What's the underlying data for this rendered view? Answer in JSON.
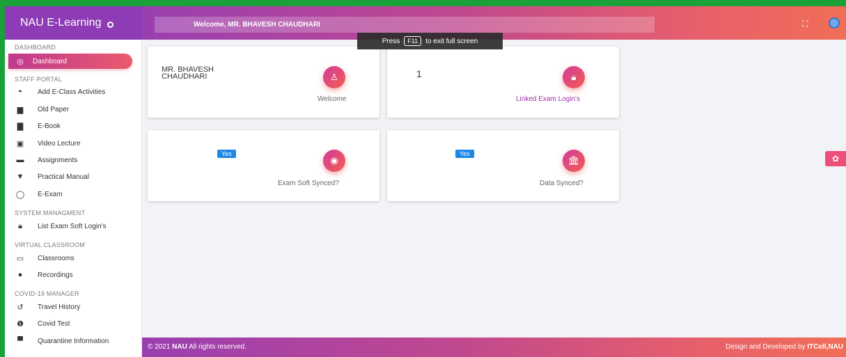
{
  "brand": {
    "title": "NAU E-Learning"
  },
  "header": {
    "welcome": "Welcome, MR. BHAVESH CHAUDHARI"
  },
  "fullscreen_tip": {
    "press": "Press",
    "key": "F11",
    "rest": "to exit full screen"
  },
  "sidebar": {
    "sections": [
      {
        "title": "DASHBOARD"
      },
      {
        "title": "STAFF PORTAL"
      },
      {
        "title": "SYSTEM MANAGMENT"
      },
      {
        "title": "VIRTUAL CLASSROOM"
      },
      {
        "title": "COVID-19 MANAGER"
      }
    ],
    "items": [
      {
        "label": "Dashboard",
        "icon": "palette-icon"
      },
      {
        "label": "Add E-Class Activities",
        "icon": "eye-icon"
      },
      {
        "label": "Old Paper",
        "icon": "file-icon"
      },
      {
        "label": "E-Book",
        "icon": "save-icon"
      },
      {
        "label": "Video Lecture",
        "icon": "video-icon"
      },
      {
        "label": "Assignments",
        "icon": "folder-icon"
      },
      {
        "label": "Practical Manual",
        "icon": "flask-icon"
      },
      {
        "label": "E-Exam",
        "icon": "disc-icon"
      },
      {
        "label": "List Exam Soft Login's",
        "icon": "lock-icon"
      },
      {
        "label": "Classrooms",
        "icon": "laptop-icon"
      },
      {
        "label": "Recordings",
        "icon": "record-icon"
      },
      {
        "label": "Travel History",
        "icon": "history-icon"
      },
      {
        "label": "Covid Test",
        "icon": "alert-icon"
      },
      {
        "label": "Quarantine Information",
        "icon": "id-card-icon"
      }
    ]
  },
  "cards": {
    "welcome": {
      "name": "MR. BHAVESH\nCHAUDHARI",
      "caption": "Welcome"
    },
    "linked": {
      "value": "1",
      "caption": "Linked Exam Login's"
    },
    "exam_soft": {
      "badge": "Yes",
      "caption": "Exam Soft Synced?"
    },
    "data_synced": {
      "badge": "Yes",
      "caption": "Data Synced?"
    }
  },
  "footer": {
    "copyright_prefix": "© 2021 ",
    "copyright_org": "NAU",
    "copyright_suffix": " All rights reserved.",
    "credit_prefix": "Design and Developed by ",
    "credit_org": "ITCell,NAU"
  },
  "colors": {
    "brand_purple": "#8e3bb6",
    "accent_pink": "#e8606a",
    "badge_blue": "#1e88e5",
    "frame_green": "#1aa13a"
  }
}
